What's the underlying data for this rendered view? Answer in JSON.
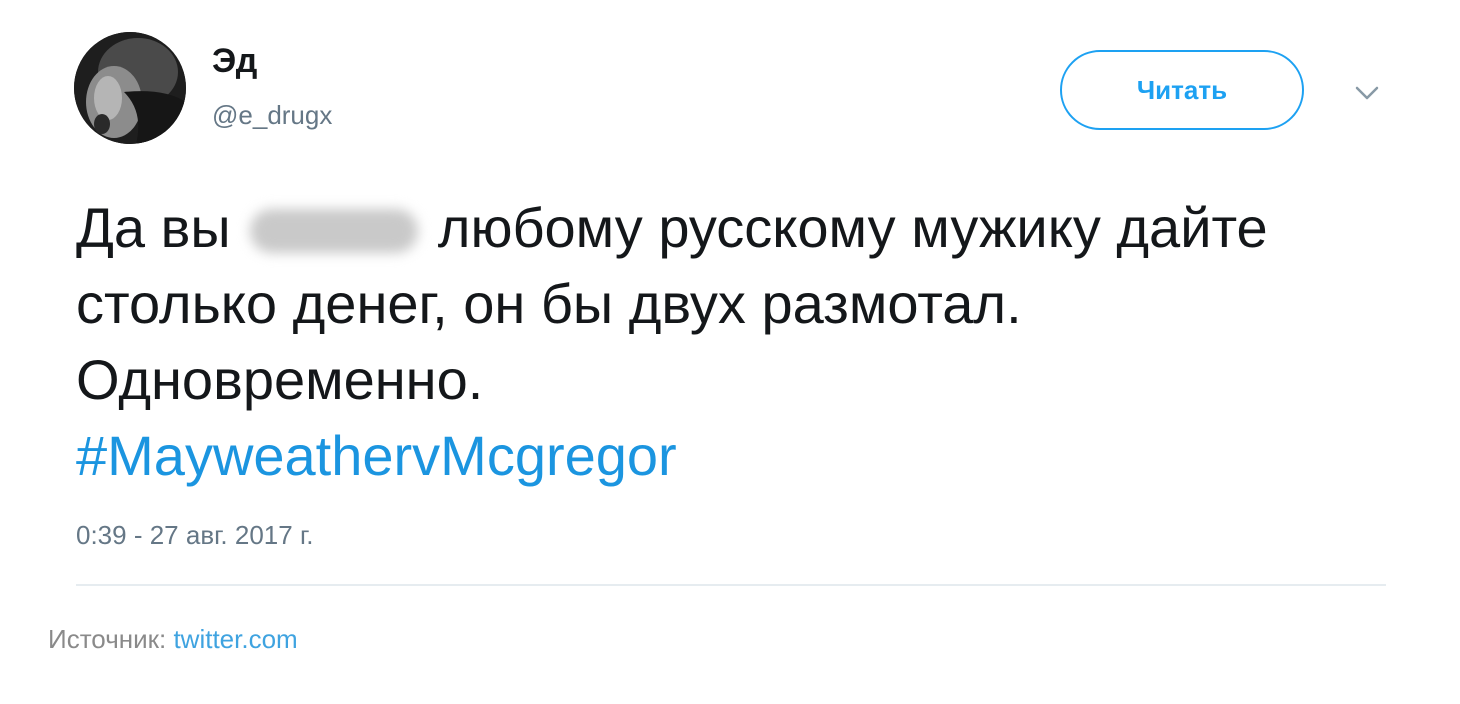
{
  "author": {
    "name": "Эд",
    "handle": "@e_drugx",
    "avatar_icon": "profile-avatar"
  },
  "actions": {
    "follow_label": "Читать",
    "menu_icon": "chevron-down-icon"
  },
  "tweet": {
    "text_part1": "Да вы",
    "text_part2": "любому русскому мужику дайте столько денег, он бы двух размотал. Одновременно.",
    "hashtag": "#MayweathervMcgregor",
    "timestamp": "0:39 - 27 авг. 2017 г."
  },
  "footer": {
    "source_label": "Источник:",
    "source_link": "twitter.com"
  },
  "colors": {
    "accent": "#1da1f2",
    "hashtag": "#1b95e0",
    "secondary_text": "#657786",
    "primary_text": "#14171a",
    "divider": "#e6ecf0"
  }
}
